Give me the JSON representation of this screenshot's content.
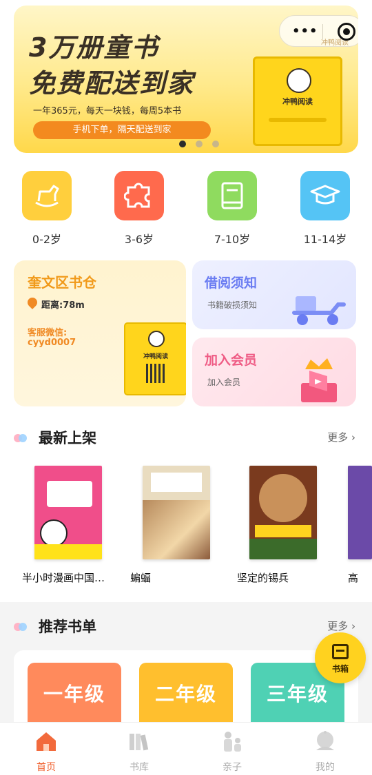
{
  "banner": {
    "line1": "3万册童书",
    "line2": "免费配送到家",
    "subtitle": "一年365元，每天一块钱，每周5本书",
    "cta": "手机下单，隔天配送到家",
    "box_name": "冲鸭阅读",
    "dots": 3,
    "active_dot": 0
  },
  "capsule": {
    "more": "•••",
    "logo": "冲鸭阅读"
  },
  "categories": [
    {
      "label": "0-2岁",
      "icon": "rocking-horse-icon",
      "color": "#ffcf3d"
    },
    {
      "label": "3-6岁",
      "icon": "puzzle-icon",
      "color": "#ff6a4d"
    },
    {
      "label": "7-10岁",
      "icon": "book-icon",
      "color": "#8fdb5f"
    },
    {
      "label": "11-14岁",
      "icon": "graduation-cap-icon",
      "color": "#55c4f5"
    }
  ],
  "store_card": {
    "title": "奎文区书仓",
    "distance": "距离:78m",
    "wechat_label": "客服微信:",
    "wechat_id": "cyyd0007",
    "locker_name": "冲鸭阅读"
  },
  "borrow_card": {
    "title": "借阅须知",
    "sub": "书籍破损须知"
  },
  "member_card": {
    "title": "加入会员",
    "sub": "加入会员"
  },
  "new_section": {
    "title": "最新上架",
    "more": "更多 ›"
  },
  "books": [
    {
      "name": "半小时漫画中国…",
      "color": "#f04e8a"
    },
    {
      "name": "蝙蝠",
      "color": "#d9c7a3"
    },
    {
      "name": "坚定的锡兵",
      "color": "#7a3a1e"
    },
    {
      "name": "高",
      "color": "#6b4aa8"
    }
  ],
  "rec_section": {
    "title": "推荐书单",
    "more": "更多 ›"
  },
  "grades": [
    {
      "label": "一年级",
      "color": "#ff8a5c"
    },
    {
      "label": "二年级",
      "color": "#ffbf2e"
    },
    {
      "label": "三年级",
      "color": "#4fd1b4"
    }
  ],
  "fab": {
    "label": "书箱"
  },
  "tabs": [
    {
      "label": "首页",
      "icon": "home-icon",
      "active": true
    },
    {
      "label": "书库",
      "icon": "books-icon",
      "active": false
    },
    {
      "label": "亲子",
      "icon": "parent-child-icon",
      "active": false
    },
    {
      "label": "我的",
      "icon": "profile-icon",
      "active": false
    }
  ]
}
